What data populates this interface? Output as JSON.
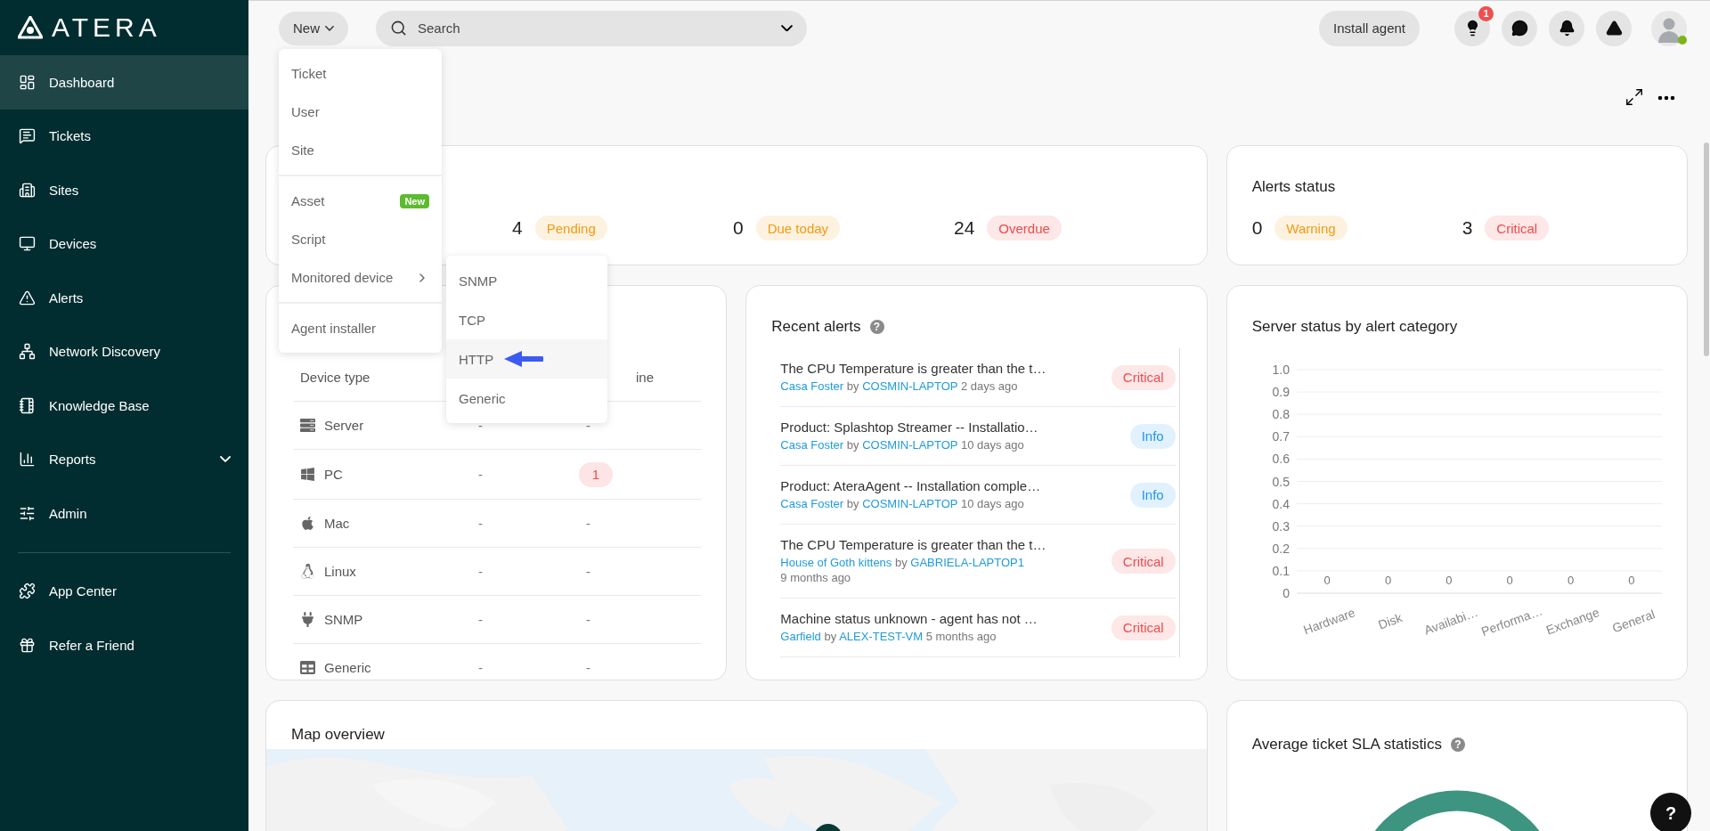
{
  "sidebar": {
    "brand": "ATERA",
    "items": [
      {
        "label": "Dashboard",
        "selected": true,
        "expandable": false
      },
      {
        "label": "Tickets",
        "selected": false,
        "expandable": false
      },
      {
        "label": "Sites",
        "selected": false,
        "expandable": false
      },
      {
        "label": "Devices",
        "selected": false,
        "expandable": false
      },
      {
        "label": "Alerts",
        "selected": false,
        "expandable": false
      },
      {
        "label": "Network Discovery",
        "selected": false,
        "expandable": false
      },
      {
        "label": "Knowledge Base",
        "selected": false,
        "expandable": false
      },
      {
        "label": "Reports",
        "selected": false,
        "expandable": true
      },
      {
        "label": "Admin",
        "selected": false,
        "expandable": false
      }
    ],
    "bottom_items": [
      {
        "label": "App Center",
        "selected": false,
        "expandable": false
      },
      {
        "label": "Refer a Friend",
        "selected": false,
        "expandable": false
      }
    ]
  },
  "topbar": {
    "new_button": "New",
    "search": {
      "placeholder": "Search"
    },
    "install_button": "Install agent",
    "tips_badge": "1",
    "user": {
      "online": true
    }
  },
  "new_menu": {
    "open": true,
    "groups": [
      [
        {
          "label": "Ticket",
          "has_submenu": false
        },
        {
          "label": "User",
          "has_submenu": false
        },
        {
          "label": "Site",
          "has_submenu": false
        }
      ],
      [
        {
          "label": "Asset",
          "badge": "New",
          "has_submenu": false
        },
        {
          "label": "Script",
          "has_submenu": false
        },
        {
          "label": "Monitored device",
          "has_submenu": true
        }
      ],
      [
        {
          "label": "Agent installer",
          "has_submenu": false
        }
      ]
    ],
    "submenu": {
      "open": true,
      "items": [
        {
          "label": "SNMP",
          "selected": false
        },
        {
          "label": "TCP",
          "selected": false
        },
        {
          "label": "HTTP",
          "selected": true
        },
        {
          "label": "Generic",
          "selected": false
        }
      ]
    }
  },
  "tickets_card": {
    "stats": [
      {
        "count": "4",
        "label": "Pending",
        "color": "#f29a12"
      },
      {
        "count": "0",
        "label": "Due today",
        "color": "#f29a12"
      },
      {
        "count": "24",
        "label": "Overdue",
        "color": "#ee4c4c"
      }
    ]
  },
  "alerts_status": {
    "title": "Alerts status",
    "stats": [
      {
        "count": "0",
        "label": "Warning",
        "color": "#f29a12"
      },
      {
        "count": "3",
        "label": "Critical",
        "color": "#ee4c4c"
      }
    ]
  },
  "devices_card": {
    "column_1": "Device type",
    "column_3": "ine",
    "rows": [
      {
        "type": "Server",
        "column_2": "-",
        "column_3": {
          "text": "-",
          "flagged": false
        }
      },
      {
        "type": "PC",
        "column_2": "-",
        "column_3": {
          "text": "1",
          "flagged": true
        }
      },
      {
        "type": "Mac",
        "column_2": "-",
        "column_3": {
          "text": "-",
          "flagged": false
        }
      },
      {
        "type": "Linux",
        "column_2": "-",
        "column_3": {
          "text": "-",
          "flagged": false
        }
      },
      {
        "type": "SNMP",
        "column_2": "-",
        "column_3": {
          "text": "-",
          "flagged": false
        }
      },
      {
        "type": "Generic",
        "column_2": "-",
        "column_3": {
          "text": "-",
          "flagged": false
        }
      }
    ]
  },
  "recent_alerts": {
    "title": "Recent alerts",
    "help": "?",
    "items": [
      {
        "title": "The CPU Temperature is greater than the t…",
        "site": "Casa Foster",
        "by": "by",
        "device": "COSMIN-LAPTOP",
        "time": "2 days ago",
        "severity": "Critical",
        "color": "#ee4c4c"
      },
      {
        "title": "Product: Splashtop Streamer -- Installatio…",
        "site": "Casa Foster",
        "by": "by",
        "device": "COSMIN-LAPTOP",
        "time": "10 days ago",
        "severity": "Info",
        "color": "#2196f3"
      },
      {
        "title": "Product: AteraAgent -- Installation comple…",
        "site": "Casa Foster",
        "by": "by",
        "device": "COSMIN-LAPTOP",
        "time": "10 days ago",
        "severity": "Info",
        "color": "#2196f3"
      },
      {
        "title": "The CPU Temperature is greater than the t…",
        "site": "House of Goth kittens",
        "by": "by",
        "device": "GABRIELA-LAPTOP1",
        "time": "9 months ago",
        "severity": "Critical",
        "color": "#ee4c4c"
      },
      {
        "title": "Machine status unknown - agent has not …",
        "site": "Garfield",
        "by": "by",
        "device": "ALEX-TEST-VM",
        "time": "5 months ago",
        "severity": "Critical",
        "color": "#ee4c4c"
      }
    ]
  },
  "server_status": {
    "title": "Server status by alert category",
    "chart_data": {
      "type": "bar",
      "categories": [
        "Hardware",
        "Disk",
        "Availabi…",
        "Performa…",
        "Exchange",
        "General"
      ],
      "values": [
        0,
        0,
        0,
        0,
        0,
        0
      ],
      "ylim": [
        0,
        1
      ],
      "yticks": [
        0,
        0.1,
        0.2,
        0.3,
        0.4,
        0.5,
        0.6,
        0.7,
        0.8,
        0.9,
        {
          "value": 1,
          "label": "1.0"
        }
      ],
      "grid": true,
      "value_labels": [
        "0",
        "0",
        "0",
        "0",
        "0",
        "0"
      ]
    }
  },
  "map_card": {
    "title": "Map overview"
  },
  "sla_card": {
    "title": "Average ticket SLA statistics",
    "help": "?"
  },
  "help_button": "?"
}
